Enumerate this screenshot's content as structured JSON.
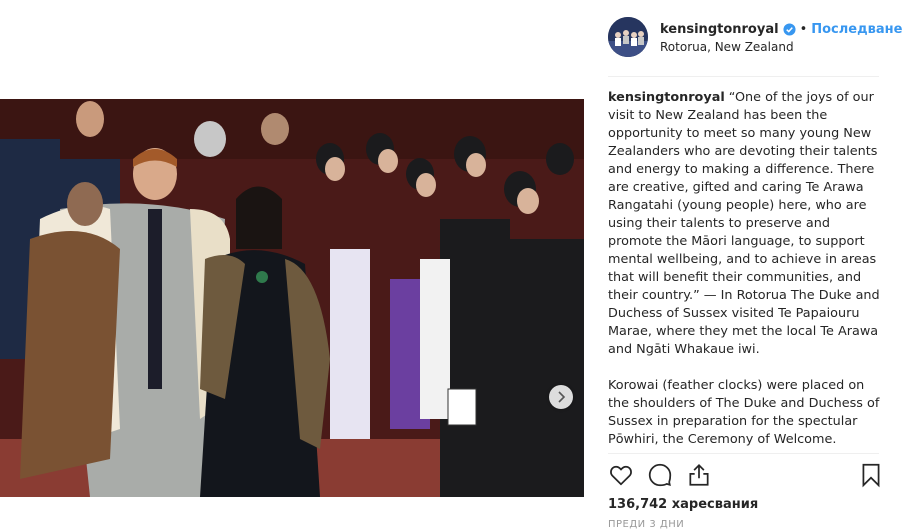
{
  "post": {
    "username": "kensingtonroyal",
    "separator": "•",
    "follow_label": "Последване",
    "location": "Rotorua, New Zealand",
    "verified_icon": "verified-badge-icon",
    "caption_username": "kensingtonroyal",
    "caption_text": " “One of the joys of our visit to New Zealand has been the opportunity to meet so many young New Zealanders who are devoting their talents and energy to making a difference. There are creative, gifted and caring Te Arawa Rangatahi (young people) here, who are using their talents to preserve and promote the Māori language, to support mental wellbeing, and to achieve in areas that will benefit their communities, and their country.” — In Rotorua The Duke and Duchess of Sussex visited Te Papaiouru Marae, where they met the local Te Arawa and Ngāti Whakaue iwi.\n\nKorowai (feather clocks) were placed on the shoulders of The Duke and Duchess of Sussex in preparation for the spectular Pōwhiri, the Ceremony of Welcome.",
    "likes": "136,742 харесвания",
    "time": "ПРЕДИ 3 ДНИ"
  },
  "icons": {
    "like": "heart-icon",
    "comment": "comment-icon",
    "share": "share-icon",
    "save": "bookmark-icon",
    "next": "chevron-right-icon"
  },
  "colors": {
    "accent": "#3897f0",
    "text": "#262626",
    "muted": "#999999"
  }
}
